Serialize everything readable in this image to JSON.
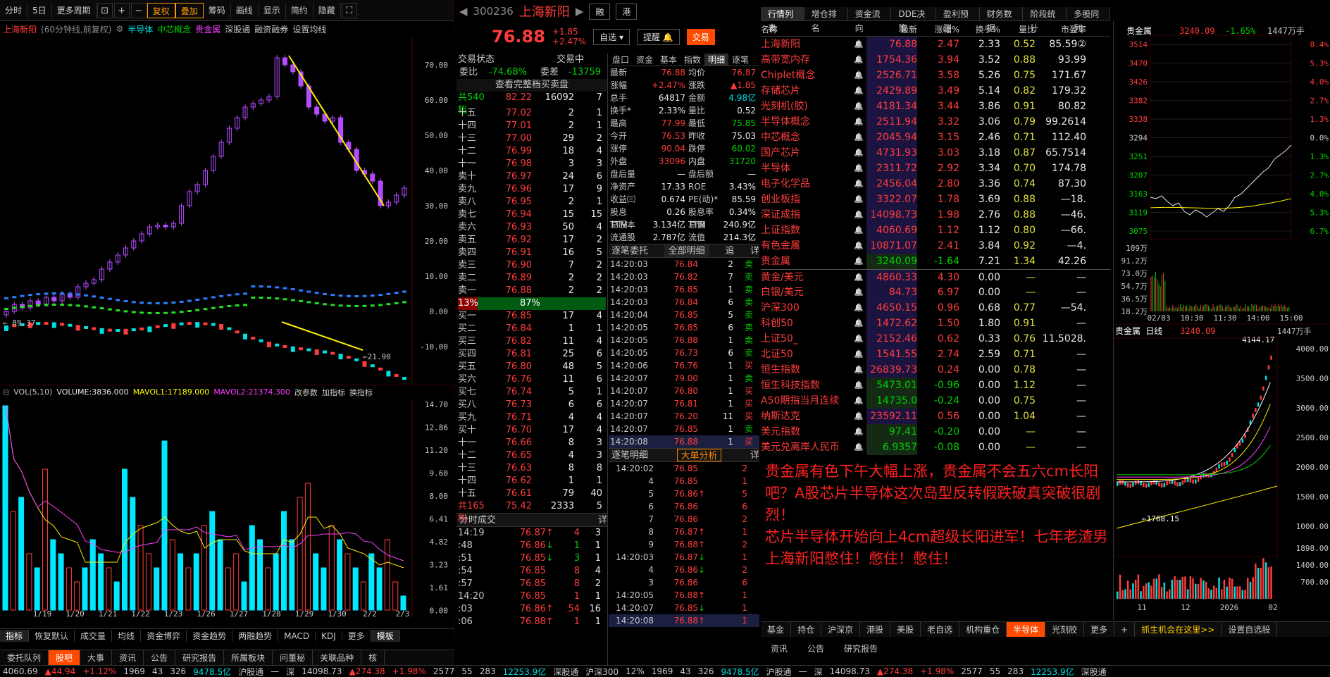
{
  "toolbar": {
    "items": [
      "分时",
      "5日",
      "更多周期",
      "复权",
      "叠加",
      "筹码",
      "画线",
      "显示",
      "简约",
      "隐藏"
    ]
  },
  "kline": {
    "title": "上海新阳",
    "period": "(60分钟线,前复权)",
    "overlays": [
      "半导体",
      "中芯概念",
      "贵金属"
    ],
    "links": [
      "深股通",
      "融资融券",
      "设置均线"
    ],
    "ylabels": [
      "70.00",
      "60.00",
      "50.00",
      "40.00",
      "30.00",
      "20.00",
      "10.00",
      "0.00",
      "-10.00"
    ],
    "low_label": "89.37",
    "low_label2": "21.90"
  },
  "volume": {
    "label": "VOL(5,10)",
    "volume": "VOLUME:3836.000",
    "mavol1": "MAVOL1:17189.000",
    "mavol2": "MAVOL2:21374.300",
    "links": [
      "改参数",
      "加指标",
      "换指标"
    ],
    "ylabels": [
      "14.70",
      "12.86",
      "11.20",
      "9.60",
      "8.00",
      "6.41",
      "4.82",
      "3.23",
      "1.61",
      "0.00"
    ],
    "xlabels": [
      "1/19",
      "1/20",
      "1/21",
      "1/22",
      "1/23",
      "1/26",
      "1/27",
      "1/28",
      "1/29",
      "1/30",
      "2/2",
      "2/3"
    ]
  },
  "lbtm1": [
    "指标",
    "恢复默认",
    "成交量",
    "均线",
    "资金博弈",
    "资金趋势",
    "两融趋势",
    "MACD",
    "KDJ",
    "更多",
    "模板"
  ],
  "lbtm2": [
    "委托队列",
    "股吧",
    "大事",
    "资讯",
    "公告",
    "研究报告",
    "所属板块",
    "问董秘",
    "关联品种",
    "核"
  ],
  "stock": {
    "code": "300236",
    "name": "上海新阳",
    "tag1": "融",
    "tag2": "港",
    "price": "76.88",
    "change": "+1.85",
    "pct": "+2.47%",
    "btn_self": "自选",
    "btn_remind": "提醒",
    "btn_trade": "交易"
  },
  "ob": {
    "status_label": "交易状态",
    "status_val": "交易中",
    "wb_label": "委比",
    "wb": "-74.68%",
    "wc_label": "委差",
    "wc": "-13759",
    "full_btn": "查看完整档买卖盘",
    "sell_total_label": "共540档",
    "sell_total_price": "82.22",
    "sell_total_vol": "16092",
    "sell_total_n": "7",
    "sells": [
      [
        "十五",
        "77.02",
        "2",
        "1"
      ],
      [
        "十四",
        "77.01",
        "2",
        "1"
      ],
      [
        "十三",
        "77.00",
        "29",
        "2"
      ],
      [
        "十二",
        "76.99",
        "18",
        "4"
      ],
      [
        "十一",
        "76.98",
        "3",
        "3"
      ],
      [
        "卖十",
        "76.97",
        "24",
        "6"
      ],
      [
        "卖九",
        "76.96",
        "17",
        "9"
      ],
      [
        "卖八",
        "76.95",
        "2",
        "1"
      ],
      [
        "卖七",
        "76.94",
        "15",
        "15"
      ],
      [
        "卖六",
        "76.93",
        "50",
        "4"
      ],
      [
        "卖五",
        "76.92",
        "17",
        "2"
      ],
      [
        "卖四",
        "76.91",
        "16",
        "5"
      ],
      [
        "卖三",
        "76.90",
        "7",
        "2"
      ],
      [
        "卖二",
        "76.89",
        "2",
        "2"
      ],
      [
        "卖一",
        "76.88",
        "2",
        "2"
      ]
    ],
    "ratio_sell": "13%",
    "ratio_buy": "87%",
    "buys": [
      [
        "买一",
        "76.85",
        "17",
        "4"
      ],
      [
        "买二",
        "76.84",
        "1",
        "1"
      ],
      [
        "买三",
        "76.82",
        "11",
        "4"
      ],
      [
        "买四",
        "76.81",
        "25",
        "6"
      ],
      [
        "买五",
        "76.80",
        "48",
        "5"
      ],
      [
        "买六",
        "76.76",
        "11",
        "6"
      ],
      [
        "买七",
        "76.74",
        "5",
        "1"
      ],
      [
        "买八",
        "76.73",
        "6",
        "6"
      ],
      [
        "买九",
        "76.71",
        "4",
        "4"
      ],
      [
        "买十",
        "76.70",
        "17",
        "4"
      ],
      [
        "十一",
        "76.66",
        "8",
        "3"
      ],
      [
        "十二",
        "76.65",
        "4",
        "3"
      ],
      [
        "十三",
        "76.63",
        "8",
        "8"
      ],
      [
        "十四",
        "76.62",
        "1",
        "1"
      ],
      [
        "十五",
        "76.61",
        "79",
        "40"
      ]
    ],
    "buy_total_label": "共165档",
    "buy_total_price": "75.42",
    "buy_total_vol": "2333",
    "buy_total_n": "5",
    "ticks_title": "分时成交",
    "ticks_btn": "详",
    "ticks": [
      [
        "14:19",
        "76.87",
        "↑",
        "4",
        "3"
      ],
      [
        ":48",
        "76.86",
        "↓",
        "1",
        "1"
      ],
      [
        ":51",
        "76.85",
        "↓",
        "3",
        "1"
      ],
      [
        ":54",
        "76.85",
        "",
        "8",
        "4"
      ],
      [
        ":57",
        "76.85",
        "",
        "8",
        "2"
      ],
      [
        "14:20",
        "76.85",
        "",
        "1",
        "1"
      ],
      [
        ":03",
        "76.86",
        "↑",
        "54",
        "16"
      ],
      [
        ":06",
        "76.88",
        "↑",
        "1",
        "1"
      ]
    ]
  },
  "detail": {
    "tabs": [
      "盘口",
      "资金",
      "基本",
      "指数",
      "明细",
      "逐笔"
    ],
    "rows": [
      [
        "最新",
        "76.88",
        "均价",
        "76.87"
      ],
      [
        "涨幅",
        "+2.47%",
        "涨跌",
        "▲1.85"
      ],
      [
        "总手",
        "64817",
        "金额",
        "4.98亿"
      ],
      [
        "换手*",
        "2.33%",
        "量比",
        "0.52"
      ],
      [
        "最高",
        "77.99",
        "最低",
        "75.85"
      ],
      [
        "今开",
        "76.53",
        "昨收",
        "75.03"
      ],
      [
        "涨停",
        "90.04",
        "跌停",
        "60.02"
      ],
      [
        "外盘",
        "33096",
        "内盘",
        "31720"
      ],
      [
        "盘后量",
        "—",
        "盘后额",
        "—"
      ],
      [
        "净资产",
        "17.33",
        "ROE",
        "3.43%"
      ],
      [
        "收益㈢",
        "0.674",
        "PE(动)*",
        "85.59"
      ],
      [
        "股息TTM",
        "0.26",
        "股息率TTM",
        "0.34%"
      ],
      [
        "总股本",
        "3.134亿",
        "总值",
        "240.9亿"
      ],
      [
        "流通股",
        "2.787亿",
        "流值",
        "214.3亿"
      ]
    ],
    "zb_title": "逐笔委托",
    "zb_filter": "全部明细",
    "zb_b1": "追",
    "zb_b2": "详",
    "zb": [
      [
        "14:20:03",
        "76.84",
        "2",
        "卖"
      ],
      [
        "14:20:03",
        "76.82",
        "7",
        "卖"
      ],
      [
        "14:20:03",
        "76.85",
        "1",
        "卖"
      ],
      [
        "14:20:03",
        "76.84",
        "6",
        "卖"
      ],
      [
        "14:20:04",
        "76.85",
        "5",
        "卖"
      ],
      [
        "14:20:05",
        "76.85",
        "6",
        "卖"
      ],
      [
        "14:20:05",
        "76.88",
        "1",
        "卖"
      ],
      [
        "14:20:05",
        "76.73",
        "6",
        "卖"
      ],
      [
        "14:20:06",
        "76.76",
        "1",
        "买"
      ],
      [
        "14:20:07",
        "79.00",
        "1",
        "卖"
      ],
      [
        "14:20:07",
        "76.80",
        "1",
        "买"
      ],
      [
        "14:20:07",
        "76.81",
        "1",
        "买"
      ],
      [
        "14:20:07",
        "76.20",
        "11",
        "买"
      ],
      [
        "14:20:07",
        "76.85",
        "1",
        "卖"
      ],
      [
        "14:20:08",
        "76.88",
        "1",
        "买"
      ]
    ],
    "zbmx_title": "逐笔明细",
    "zbmx_btn": "大单分析",
    "zbmx_b2": "详",
    "zbmx": [
      [
        "14:20:02",
        "76.85",
        "",
        "2"
      ],
      [
        "4",
        "76.85",
        "",
        "1"
      ],
      [
        "5",
        "76.86",
        "↑",
        "5"
      ],
      [
        "6",
        "76.86",
        "",
        "6"
      ],
      [
        "7",
        "76.86",
        "",
        "2"
      ],
      [
        "8",
        "76.87",
        "↑",
        "1"
      ],
      [
        "9",
        "76.88",
        "↑",
        "2"
      ],
      [
        "14:20:03",
        "76.87",
        "↓",
        "1"
      ],
      [
        "4",
        "76.86",
        "↓",
        "2"
      ],
      [
        "3",
        "76.86",
        "",
        "6"
      ],
      [
        "14:20:05",
        "76.88",
        "↑",
        "1"
      ],
      [
        "14:20:07",
        "76.85",
        "↓",
        "1"
      ],
      [
        "14:20:08",
        "76.88",
        "↑",
        "1"
      ]
    ]
  },
  "qt": {
    "tabs": [
      "行情列表",
      "增仓排名",
      "资金流向",
      "DDE决策",
      "盈利预测",
      "财务数据",
      "阶段统计",
      "多股同列"
    ],
    "headers": [
      "名称",
      "最新",
      "涨幅%",
      "换手%",
      "量比",
      "市盈率"
    ],
    "rows": [
      [
        "上海新阳",
        "R",
        "76.88",
        "2.47",
        "2.33",
        "0.52",
        "85.59②",
        "2"
      ],
      [
        "高带宽内存",
        "",
        "1754.36",
        "3.94",
        "3.52",
        "0.88",
        "93.99",
        "1"
      ],
      [
        "Chiplet概念",
        "",
        "2526.71",
        "3.58",
        "5.26",
        "0.75",
        "171.67",
        "1"
      ],
      [
        "存储芯片",
        "",
        "2429.89",
        "3.49",
        "5.14",
        "0.82",
        "179.32",
        "3"
      ],
      [
        "光刻机(胶)",
        "",
        "4181.34",
        "3.44",
        "3.86",
        "0.91",
        "80.82",
        "1"
      ],
      [
        "半导体概念",
        "",
        "2511.94",
        "3.32",
        "3.06",
        "0.79",
        "99.2614",
        ""
      ],
      [
        "中芯概念",
        "",
        "2045.94",
        "3.15",
        "2.46",
        "0.71",
        "112.40",
        "3"
      ],
      [
        "国产芯片",
        "",
        "4731.93",
        "3.03",
        "3.18",
        "0.87",
        "65.7514",
        ""
      ],
      [
        "半导体",
        "",
        "2311.72",
        "2.92",
        "3.34",
        "0.70",
        "174.78",
        "8"
      ],
      [
        "电子化学品",
        "",
        "2456.04",
        "2.80",
        "3.36",
        "0.74",
        "87.30",
        ""
      ],
      [
        "创业板指",
        "",
        "3322.07",
        "1.78",
        "3.69",
        "0.88",
        "—18.",
        ""
      ],
      [
        "深证成指",
        "",
        "14098.73",
        "1.98",
        "2.76",
        "0.88",
        "—46.",
        ""
      ],
      [
        "上证指数",
        "",
        "4060.69",
        "1.12",
        "1.12",
        "0.80",
        "—66.",
        ""
      ],
      [
        "有色金属",
        "",
        "10871.07",
        "2.41",
        "3.84",
        "0.92",
        "—4.",
        ""
      ],
      [
        "贵金属",
        "",
        "3240.09",
        "-1.64",
        "7.21",
        "1.34",
        "42.26",
        "2"
      ],
      [
        "黄金/美元",
        "",
        "4860.33",
        "4.30",
        "0.00",
        "—",
        "—",
        ""
      ],
      [
        "白银/美元",
        "",
        "84.73",
        "6.97",
        "0.00",
        "—",
        "—",
        ""
      ],
      [
        "沪深300",
        "",
        "4650.15",
        "0.96",
        "0.68",
        "0.77",
        "—54.",
        ""
      ],
      [
        "科创50",
        "",
        "1472.62",
        "1.50",
        "1.80",
        "0.91",
        "—",
        ""
      ],
      [
        "上证50_",
        "",
        "2152.46",
        "0.62",
        "0.33",
        "0.76",
        "11.5028.",
        ""
      ],
      [
        "北证50",
        "",
        "1541.55",
        "2.74",
        "2.59",
        "0.71",
        "—",
        ""
      ],
      [
        "恒生指数",
        "",
        "26839.73",
        "0.24",
        "0.00",
        "0.78",
        "—",
        ""
      ],
      [
        "恒生科技指数",
        "",
        "5473.01",
        "-0.96",
        "0.00",
        "1.12",
        "—",
        ""
      ],
      [
        "A50期指当月连续",
        "",
        "14735.0",
        "-0.24",
        "0.00",
        "0.75",
        "—",
        ""
      ],
      [
        "纳斯达克",
        "",
        "23592.11",
        "0.56",
        "0.00",
        "1.04",
        "—",
        ""
      ],
      [
        "美元指数",
        "",
        "97.41",
        "-0.20",
        "0.00",
        "—",
        "—",
        ""
      ],
      [
        "美元兑离岸人民币",
        "",
        "6.9357",
        "-0.08",
        "0.00",
        "—",
        "—",
        ""
      ]
    ]
  },
  "news": {
    "text": [
      "贵金属有色下午大幅上涨，贵金属不会五六cm长阳吧？A股芯片半导体这次岛型反转假跌破真突破很剧烈！",
      "芯片半导体开始向上4cm超级长阳进军！七年老渣男上海新阳憋住！憋住！憋住！"
    ]
  },
  "btabs": [
    "基金",
    "持仓",
    "沪深京",
    "港股",
    "美股",
    "老自选",
    "机构重仓",
    "半导体",
    "光刻胶",
    "更多",
    "+",
    "抓生机会在这里>>",
    "设置自选股"
  ],
  "btabs2": [
    "资讯",
    "公告",
    "研究报告"
  ],
  "rightp": {
    "title": "贵金属",
    "price": "3240.09",
    "pct": "-1.65%",
    "amt": "1447万手",
    "ylabels_l": [
      "3514",
      "3470",
      "3426",
      "3382",
      "3338",
      "3294",
      "3251",
      "3207",
      "3163",
      "3119",
      "3075"
    ],
    "ylabels_r": [
      "8.4%",
      "5.3%",
      "4.0%",
      "2.7%",
      "1.3%",
      "0.0%",
      "1.3%",
      "2.7%",
      "4.0%",
      "5.3%",
      "6.7%"
    ],
    "vlabels": [
      "109万",
      "91.2万",
      "73.0万",
      "54.7万",
      "36.5万",
      "18.2万"
    ],
    "xlabels": [
      "02/03",
      "10:30",
      "11:30",
      "14:00",
      "15:00"
    ],
    "day_title": "贵金属 日线",
    "day_price": "3240.09",
    "day_amt": "1447万手",
    "day_high": "4144.17",
    "day_low": "1768.15",
    "day_ylabels": [
      "4000.00",
      "3500.00",
      "3000.00",
      "2500.00",
      "2000.00",
      "1500.00",
      "1000.00"
    ],
    "dvlabels": [
      "1898.00",
      "1400.00",
      "700.00"
    ],
    "day_xlabels": [
      "11",
      "12",
      "2026",
      "02"
    ]
  },
  "status": {
    "items": [
      "4060.69",
      "▲44.94",
      "+1.12%",
      "1969",
      "43",
      "326",
      "9478.5亿",
      "沪股通",
      "一",
      "深",
      "14098.73",
      "▲274.38",
      "+1.98%",
      "2577",
      "55",
      "283",
      "12253.9亿",
      "深股通",
      "沪深300",
      "12%",
      "1969",
      "43",
      "326",
      "9478.5亿",
      "沪股通",
      "一",
      "深",
      "14098.73",
      "▲274.38",
      "+1.98%",
      "2577",
      "55",
      "283",
      "12253.9亿",
      "深股通"
    ]
  }
}
